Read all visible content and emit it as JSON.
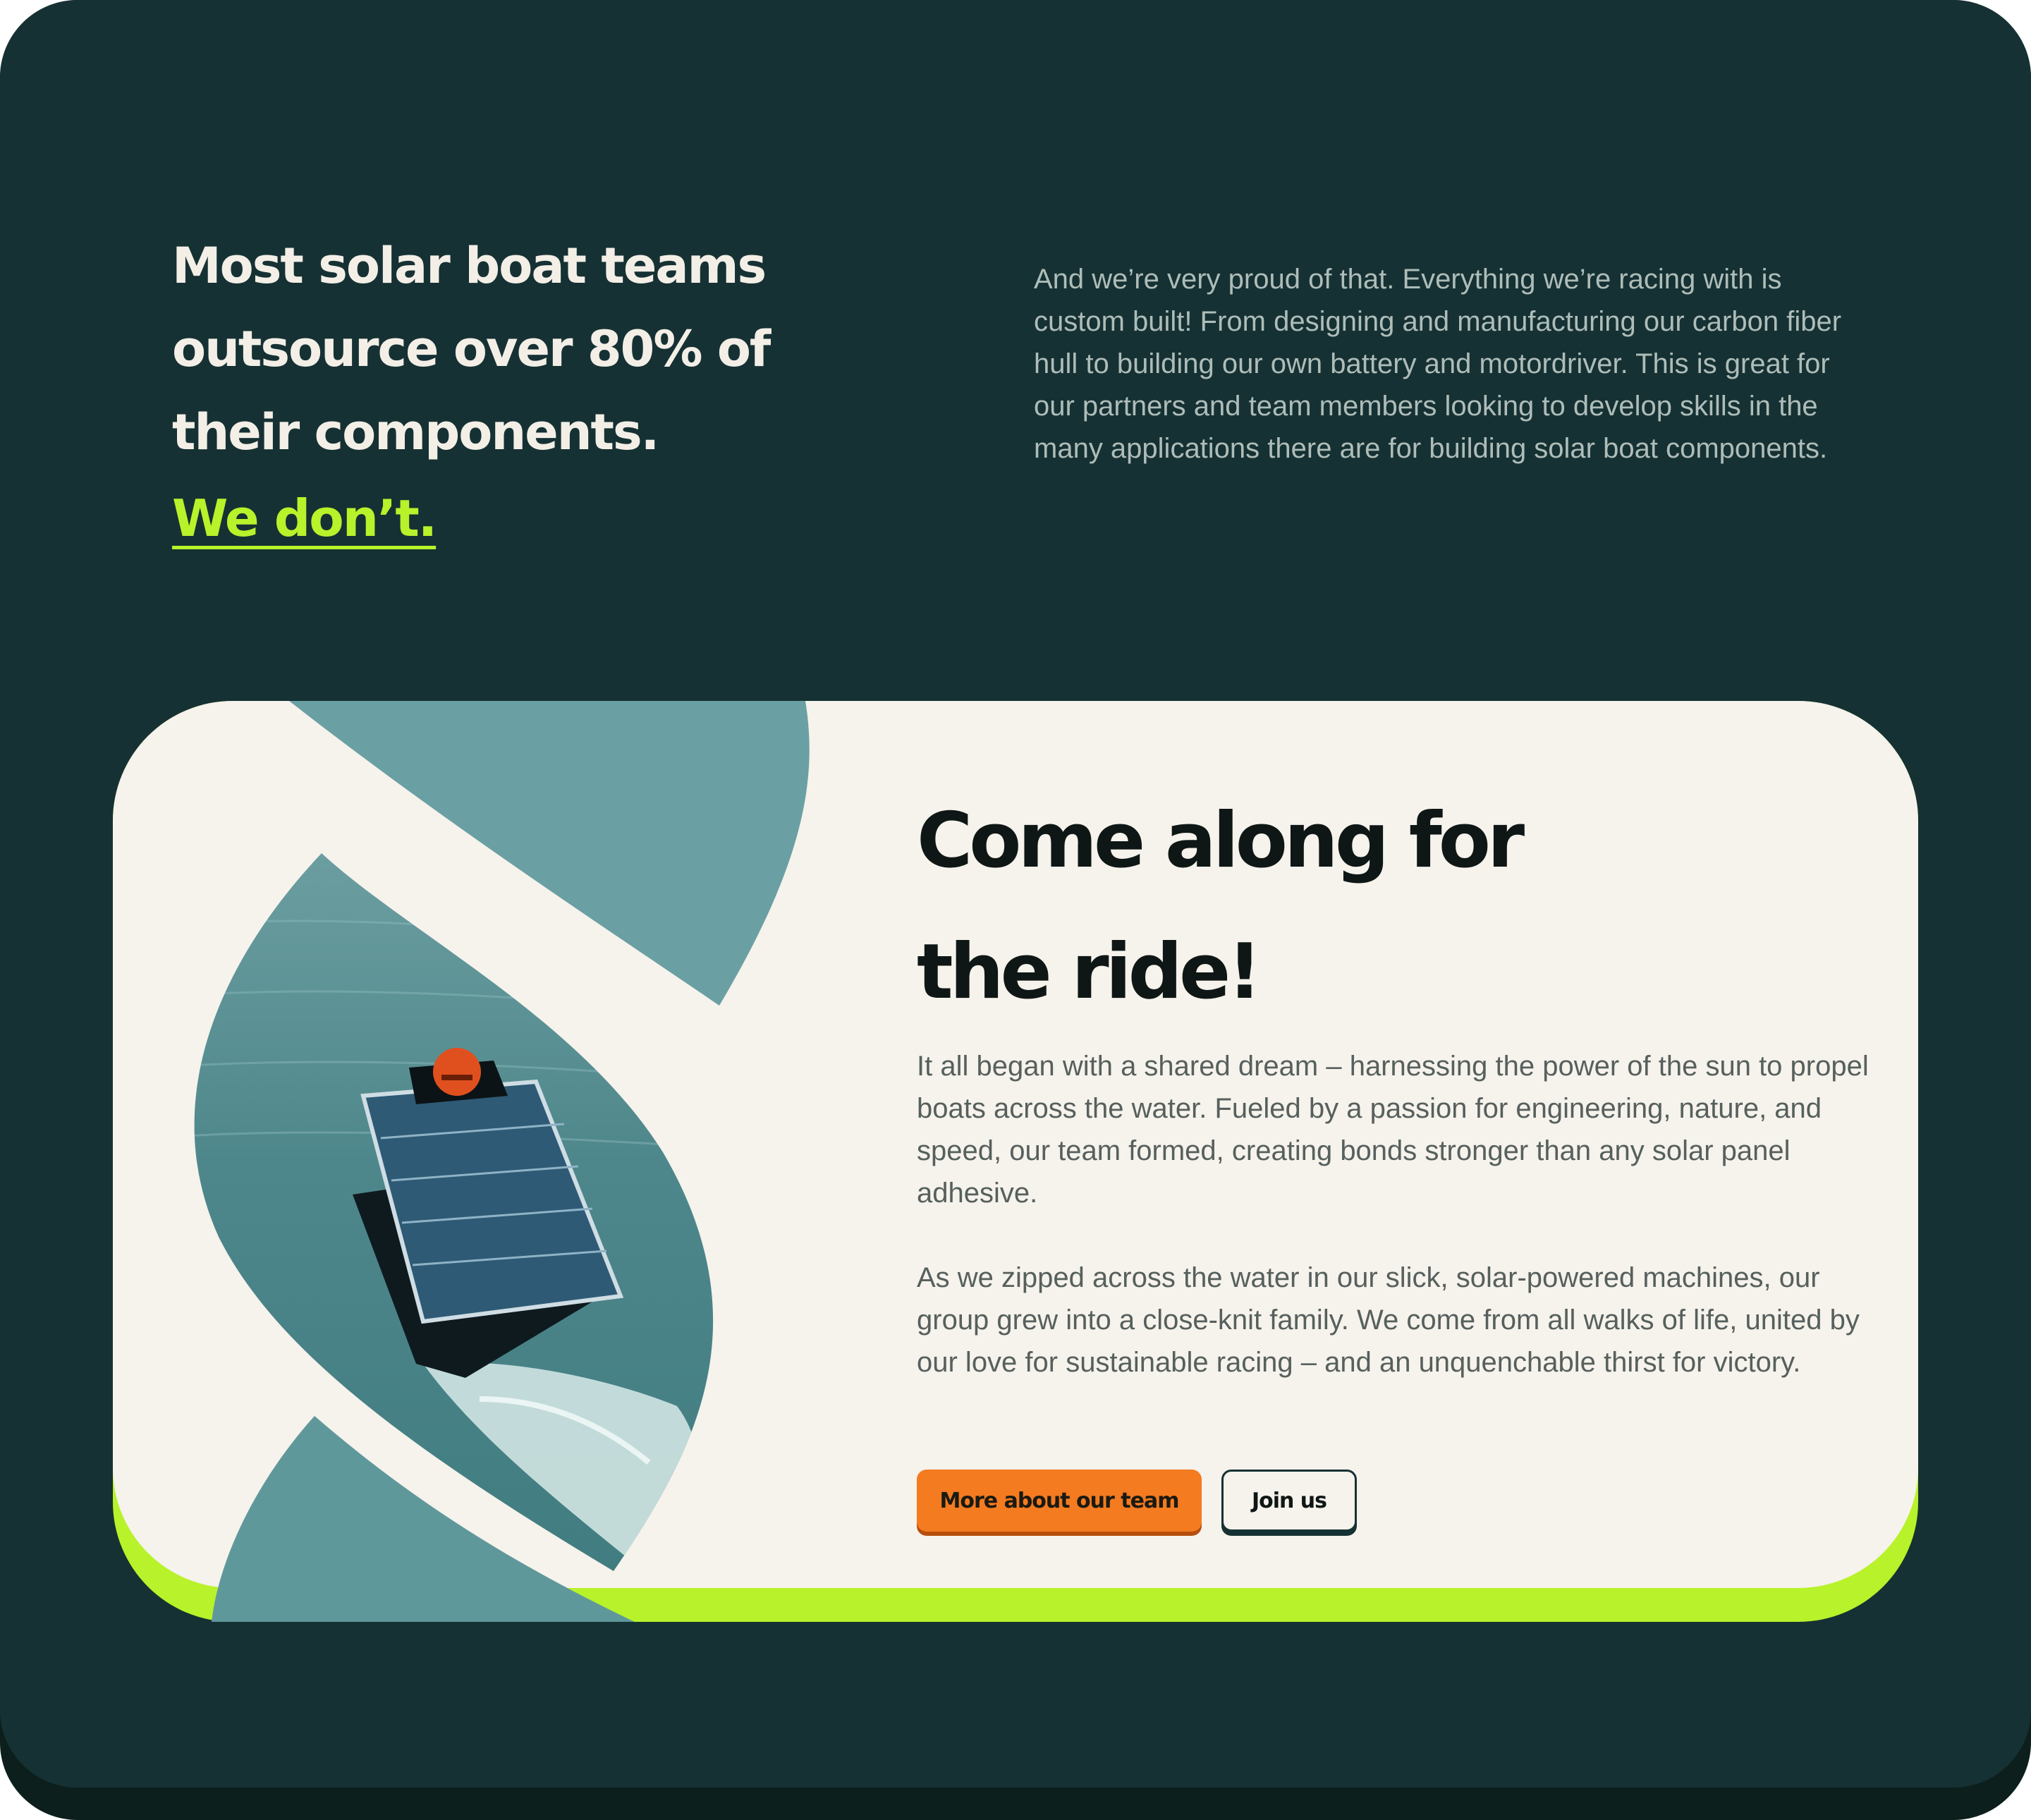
{
  "intro": {
    "heading_lines": [
      "Most solar boat teams",
      "outsource over 80% of",
      "their components."
    ],
    "highlight": "We don’t.",
    "body": "And we’re very proud of that. Everything we’re racing with is custom built! From designing and manufacturing our carbon fiber hull to building our own battery and motordriver. This is great for our partners and team members looking to develop skills in the many applications there are for building solar boat components."
  },
  "card": {
    "title_lines": [
      "Come along for",
      "the ride!"
    ],
    "paragraphs": [
      "It all began with a shared dream – harnessing the power of the sun to propel boats across the water.  Fueled by a passion for engineering, nature, and speed, our team formed, creating bonds stronger than any solar panel adhesive.",
      "As we zipped across the water in our slick, solar-powered machines, our group grew into a close-knit family. We come from all walks of life, united by our love for sustainable racing – and an unquenchable thirst for victory."
    ],
    "buttons": {
      "primary": "More about our team",
      "secondary": "Join us"
    }
  },
  "colors": {
    "page_background": "#163133",
    "accent_green": "#b8f22a",
    "accent_orange": "#f47b20",
    "card_background": "#f6f2ec",
    "water": "#6a9ea1"
  },
  "image": {
    "subject": "solar-powered boat on water with driver in orange helmet"
  }
}
